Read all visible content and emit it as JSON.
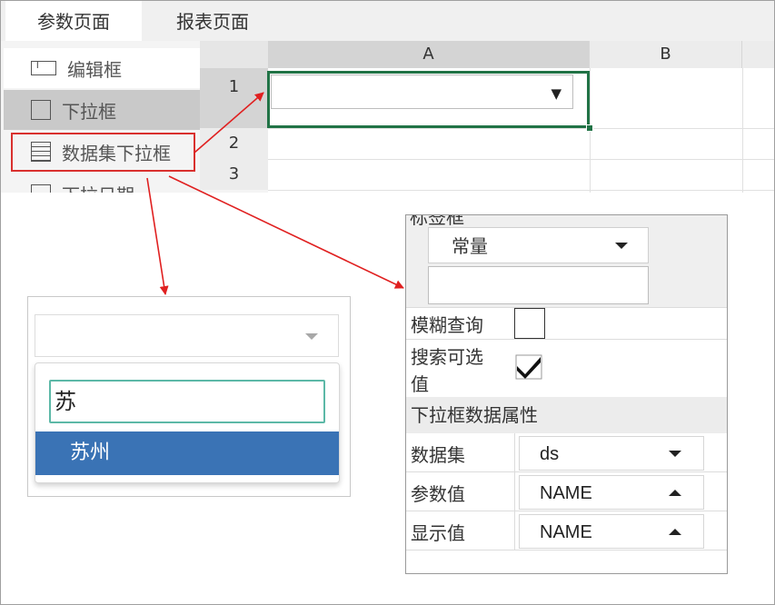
{
  "tabs": [
    {
      "label": "参数页面",
      "active": true
    },
    {
      "label": "报表页面",
      "active": false
    }
  ],
  "widgets": [
    {
      "label": "编辑框",
      "icon": "textbox-icon"
    },
    {
      "label": "下拉框",
      "icon": "combobox-icon"
    },
    {
      "label": "数据集下拉框",
      "icon": "dataset-combobox-icon",
      "highlighted": true
    },
    {
      "label": "下拉日期",
      "icon": "date-picker-icon"
    }
  ],
  "sheet": {
    "columns": [
      "A",
      "B"
    ],
    "rows": [
      "1",
      "2",
      "3"
    ],
    "cell_combo_arrow": "▼"
  },
  "preview": {
    "search_value": "苏",
    "option": "苏州"
  },
  "props": {
    "cut_title": "标签框",
    "const_select": "常量",
    "fuzzy_label": "模糊查询",
    "fuzzy_checked": false,
    "search_optional_label_1": "搜索可选",
    "search_optional_label_2": "值",
    "search_optional_checked": true,
    "section_title": "下拉框数据属性",
    "rows": [
      {
        "label": "数据集",
        "value": "ds",
        "caret": "down"
      },
      {
        "label": "参数值",
        "value": "NAME",
        "caret": "up"
      },
      {
        "label": "显示值",
        "value": "NAME",
        "caret": "up"
      }
    ]
  },
  "colors": {
    "selection": "#217346",
    "highlight_border": "#d9302e",
    "annotation_arrow": "#e02020",
    "option_bg": "#3a73b5",
    "search_border": "#5cb8a7"
  }
}
